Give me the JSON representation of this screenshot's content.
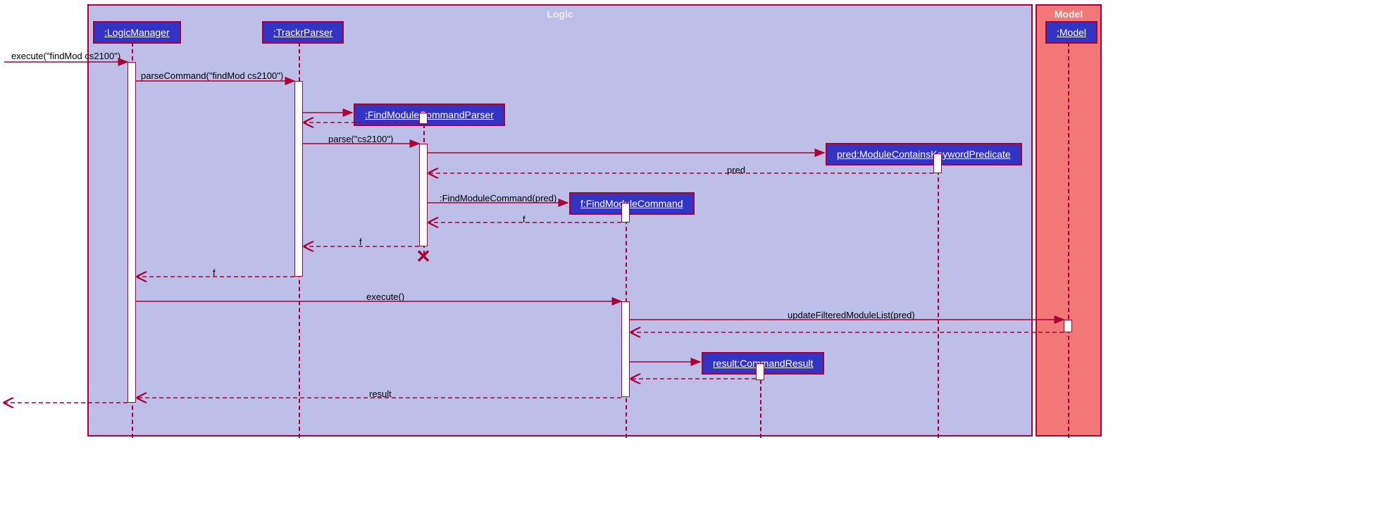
{
  "boxes": {
    "logic": {
      "label": "Logic"
    },
    "model": {
      "label": "Model"
    }
  },
  "participants": {
    "logicManager": ":LogicManager",
    "trackrParser": ":TrackrParser",
    "findModuleCommandParser": ":FindModuleCommandParser",
    "pred": "pred:ModuleContainsKeywordPredicate",
    "findModuleCommand": "f:FindModuleCommand",
    "commandResult": "result:CommandResult",
    "model": ":Model"
  },
  "messages": {
    "execute1": "execute(\"findMod cs2100\")",
    "parseCommand": "parseCommand(\"findMod cs2100\")",
    "parse": "parse(\"cs2100\")",
    "predReturn": "pred",
    "findModuleCommandCreate": ":FindModuleCommand(pred)",
    "fReturn1": "f",
    "fReturn2": "f",
    "fReturn3": "f",
    "execute2": "execute()",
    "updateFiltered": "updateFilteredModuleList(pred)",
    "resultReturn": "result"
  }
}
